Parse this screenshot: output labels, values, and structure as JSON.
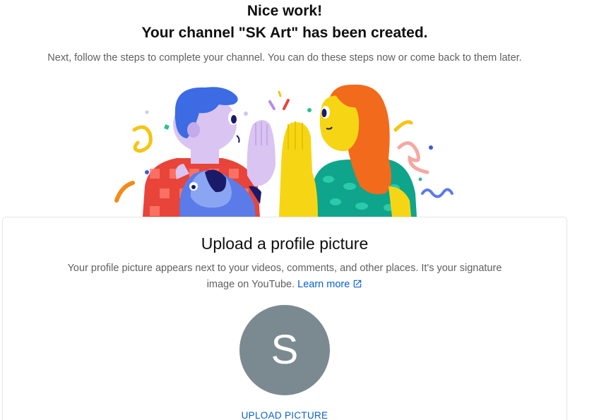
{
  "header": {
    "title_line1": "Nice work!",
    "title_line2": "Your channel \"SK Art\" has been created.",
    "subtitle": "Next, follow the steps to complete your channel. You can do these steps now or come back to them later."
  },
  "card": {
    "title": "Upload a profile picture",
    "description": "Your profile picture appears next to your videos, comments, and other places. It's your signature image on YouTube.",
    "learn_more": "Learn more",
    "avatar_letter": "S",
    "upload_button": "UPLOAD PICTURE"
  },
  "colors": {
    "link": "#065fd4",
    "avatar_bg": "#7b8a91",
    "muted_text": "#606060"
  },
  "icons": {
    "external_link": "external-link-icon"
  }
}
